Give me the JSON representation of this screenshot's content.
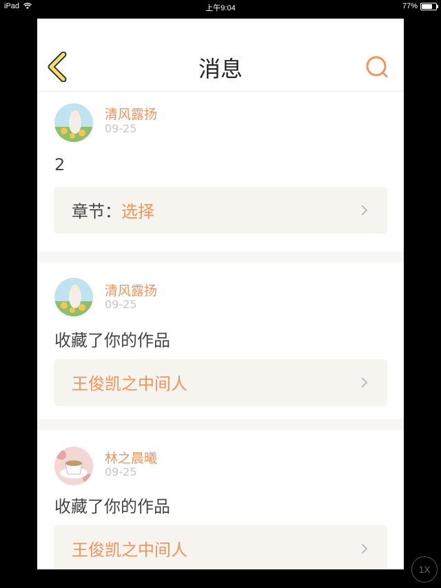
{
  "status_bar": {
    "device": "iPad",
    "time": "上午9:04",
    "battery": "77%",
    "battery_level": 0.77
  },
  "header": {
    "title": "消息",
    "back_icon": "chevron-left-icon",
    "search_icon": "search-icon"
  },
  "colors": {
    "accent": "#f4935a",
    "back_icon_fill": "#f6df6a",
    "link_box_bg": "#f5f4ef"
  },
  "messages": [
    {
      "user": "清风露扬",
      "date": "09-25",
      "content": "2",
      "link_label": "章节：",
      "link_value": "选择"
    },
    {
      "user": "清风露扬",
      "date": "09-25",
      "content": "收藏了你的作品",
      "link_label": "",
      "link_value": "王俊凯之中间人"
    },
    {
      "user": "林之晨曦",
      "date": "09-25",
      "content": "收藏了你的作品",
      "link_label": "",
      "link_value": "王俊凯之中间人"
    }
  ],
  "zoom_button": "1X"
}
